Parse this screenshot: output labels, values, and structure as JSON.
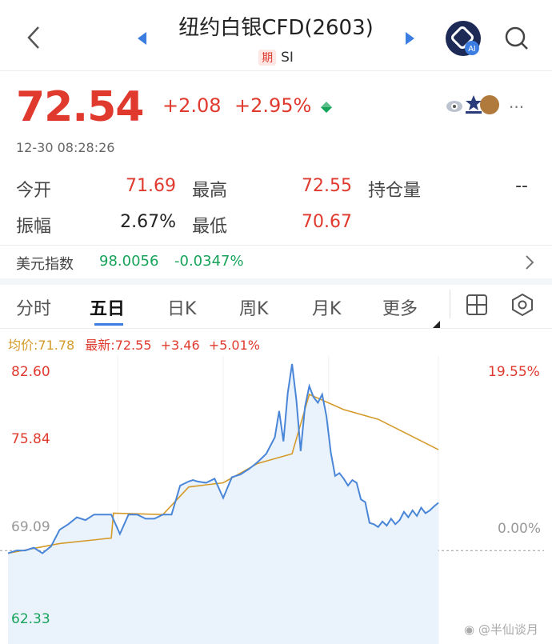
{
  "header": {
    "title": "纽约白银CFD(2603)",
    "tag": "期",
    "symbol": "SI"
  },
  "quote": {
    "price": "72.54",
    "change": "+2.08",
    "change_pct": "+2.95%",
    "time": "12-30 08:28:26"
  },
  "stats": [
    {
      "label": "今开",
      "value": "71.69",
      "color": "red"
    },
    {
      "label": "最高",
      "value": "72.55",
      "color": "red"
    },
    {
      "label": "持仓量",
      "value": "--",
      "color": "dark"
    },
    {
      "label": "振幅",
      "value": "2.67%",
      "color": "dark"
    },
    {
      "label": "最低",
      "value": "70.67",
      "color": "red"
    }
  ],
  "dollar_index": {
    "label": "美元指数",
    "value": "98.0056",
    "change": "-0.0347%"
  },
  "tabs": [
    "分时",
    "五日",
    "日K",
    "周K",
    "月K",
    "更多"
  ],
  "active_tab": "五日",
  "chart_legend": {
    "avg": "均价:71.78",
    "latest": "最新:72.55",
    "chg": "+3.46",
    "pct": "+5.01%"
  },
  "chart_data": {
    "type": "line",
    "series": [
      {
        "name": "最新",
        "x": [
          0,
          2,
          4,
          6,
          8,
          10,
          12,
          14,
          16,
          18,
          20,
          24,
          26,
          28,
          30,
          32,
          34,
          36,
          38,
          40,
          42,
          43,
          44,
          46,
          48,
          50,
          52,
          54,
          56,
          58,
          60,
          62,
          63,
          64,
          65,
          66,
          67,
          68,
          69,
          70,
          71,
          72,
          73,
          74,
          75,
          76,
          77,
          78,
          79,
          80,
          81,
          82,
          83,
          84,
          85,
          86,
          87,
          88,
          89,
          90,
          91,
          92,
          93,
          94,
          95,
          96,
          97,
          98,
          99,
          100
        ],
        "values": [
          68.9,
          69.1,
          69.1,
          69.3,
          68.9,
          69.4,
          70.6,
          71.0,
          71.5,
          71.3,
          71.7,
          71.7,
          70.3,
          71.7,
          71.7,
          71.4,
          71.4,
          71.7,
          71.7,
          73.8,
          74.1,
          74.2,
          74.1,
          74.0,
          74.3,
          72.9,
          74.4,
          74.6,
          75.0,
          75.5,
          76.1,
          77.3,
          79.2,
          77.0,
          80.5,
          82.6,
          80.0,
          76.3,
          79.5,
          81.0,
          80.2,
          79.8,
          80.4,
          78.8,
          76.2,
          74.5,
          74.7,
          74.3,
          73.8,
          74.2,
          74.0,
          72.8,
          72.6,
          71.1,
          71.0,
          70.8,
          71.2,
          70.9,
          71.4,
          71.0,
          71.3,
          71.9,
          71.5,
          72.0,
          71.6,
          72.2,
          71.8,
          72.0,
          72.3,
          72.55
        ]
      },
      {
        "name": "均价",
        "x": [
          0,
          12,
          24,
          24.5,
          36,
          42,
          50,
          58,
          66,
          70,
          78,
          86,
          100
        ],
        "values": [
          68.9,
          69.6,
          70.0,
          71.8,
          71.7,
          73.7,
          74.0,
          75.4,
          76.1,
          80.4,
          79.3,
          78.6,
          76.4
        ]
      }
    ],
    "yticks": [
      "82.60",
      "75.84",
      "69.09",
      "62.33"
    ],
    "right_ticks": [
      "19.55%",
      "0.00%"
    ],
    "ylim": [
      62.33,
      82.6
    ],
    "baseline": 69.09
  },
  "watermark": "@半仙谈月",
  "colors": {
    "up": "#e03a2e",
    "down": "#17a35a",
    "line": "#4a86d8",
    "avg": "#d49a2a",
    "fill": "#eaf3fc"
  }
}
